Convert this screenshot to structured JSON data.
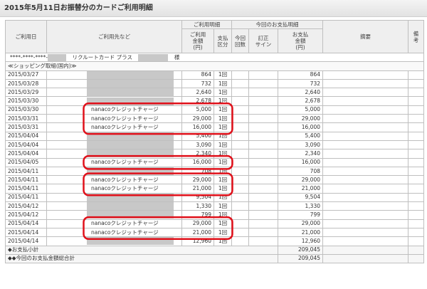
{
  "page": {
    "title": "2015年5月11日お振替分のカードご利用明細"
  },
  "headers": {
    "date": "ご利用日",
    "merchant": "ご利用先など",
    "usage_group": "ご利用明細",
    "amount": "ご利用\n金額\n(円)",
    "pay_type": "支払\n区分",
    "payment_group": "今回のお支払明細",
    "count": "今回\n回数",
    "correction": "訂正\nサイン",
    "pay_amount": "お支払\n金額\n(円)",
    "summary": "摘要",
    "remarks": "備\n考"
  },
  "card": {
    "number": "****-****-****-",
    "name": "リクルートカード プラス",
    "honorific": "様"
  },
  "section": {
    "label": "≪ショッピング取組(国内)≫"
  },
  "rows": [
    {
      "date": "2015/03/27",
      "merchant": "",
      "masked": true,
      "amount": "864",
      "type": "1回",
      "pay": "864"
    },
    {
      "date": "2015/03/28",
      "merchant": "",
      "masked": true,
      "amount": "732",
      "type": "1回",
      "pay": "732"
    },
    {
      "date": "2015/03/29",
      "merchant": "",
      "masked": true,
      "amount": "2,640",
      "type": "1回",
      "pay": "2,640"
    },
    {
      "date": "2015/03/30",
      "merchant": "",
      "masked": true,
      "amount": "2,678",
      "type": "1回",
      "pay": "2,678"
    },
    {
      "date": "2015/03/30",
      "merchant": "nanacoクレジットチャージ",
      "masked": false,
      "amount": "5,000",
      "type": "1回",
      "pay": "5,000"
    },
    {
      "date": "2015/03/31",
      "merchant": "nanacoクレジットチャージ",
      "masked": false,
      "amount": "29,000",
      "type": "1回",
      "pay": "29,000"
    },
    {
      "date": "2015/03/31",
      "merchant": "nanacoクレジットチャージ",
      "masked": false,
      "amount": "16,000",
      "type": "1回",
      "pay": "16,000"
    },
    {
      "date": "2015/04/04",
      "merchant": "",
      "masked": true,
      "amount": "5,400",
      "type": "1回",
      "pay": "5,400"
    },
    {
      "date": "2015/04/04",
      "merchant": "",
      "masked": true,
      "amount": "3,090",
      "type": "1回",
      "pay": "3,090"
    },
    {
      "date": "2015/04/04",
      "merchant": "",
      "masked": true,
      "amount": "2,340",
      "type": "1回",
      "pay": "2,340"
    },
    {
      "date": "2015/04/05",
      "merchant": "nanacoクレジットチャージ",
      "masked": false,
      "amount": "16,000",
      "type": "1回",
      "pay": "16,000"
    },
    {
      "date": "2015/04/11",
      "merchant": "",
      "masked": true,
      "amount": "708",
      "type": "1回",
      "pay": "708"
    },
    {
      "date": "2015/04/11",
      "merchant": "nanacoクレジットチャージ",
      "masked": false,
      "amount": "29,000",
      "type": "1回",
      "pay": "29,000"
    },
    {
      "date": "2015/04/11",
      "merchant": "nanacoクレジットチャージ",
      "masked": false,
      "amount": "21,000",
      "type": "1回",
      "pay": "21,000"
    },
    {
      "date": "2015/04/11",
      "merchant": "",
      "masked": true,
      "amount": "9,504",
      "type": "1回",
      "pay": "9,504"
    },
    {
      "date": "2015/04/12",
      "merchant": "",
      "masked": true,
      "amount": "1,330",
      "type": "1回",
      "pay": "1,330"
    },
    {
      "date": "2015/04/12",
      "merchant": "",
      "masked": true,
      "amount": "799",
      "type": "1回",
      "pay": "799"
    },
    {
      "date": "2015/04/14",
      "merchant": "nanacoクレジットチャージ",
      "masked": false,
      "amount": "29,000",
      "type": "1回",
      "pay": "29,000"
    },
    {
      "date": "2015/04/14",
      "merchant": "nanacoクレジットチャージ",
      "masked": false,
      "amount": "21,000",
      "type": "1回",
      "pay": "21,000"
    },
    {
      "date": "2015/04/14",
      "merchant": "",
      "masked": true,
      "amount": "12,960",
      "type": "1回",
      "pay": "12,960"
    }
  ],
  "subtotal": {
    "label": "◆お支払小計",
    "value": "209,045"
  },
  "total": {
    "label": "◆◆今回のお支払金額総合計",
    "value": "209,045"
  },
  "annotation": {
    "color": "#e0101a"
  }
}
